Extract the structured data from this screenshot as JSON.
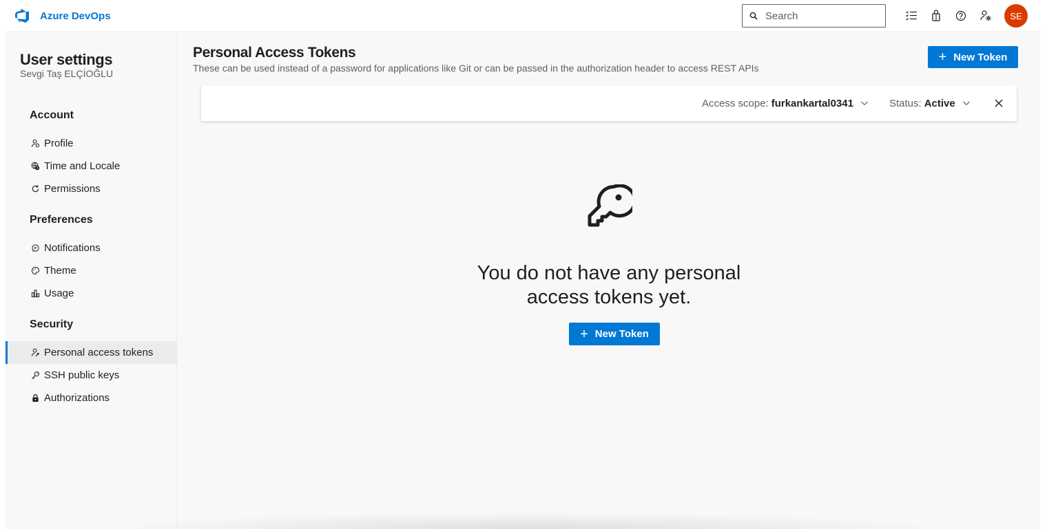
{
  "header": {
    "brand_name": "Azure DevOps",
    "search_placeholder": "Search",
    "avatar_initials": "SE",
    "icons": [
      "work-items-icon",
      "marketplace-bag-icon",
      "help-icon",
      "user-settings-icon"
    ],
    "avatar_color": "#da3b01"
  },
  "sidebar": {
    "title": "User settings",
    "user_name": "Sevgi Taş ELÇİOĞLU",
    "groups": [
      {
        "label": "Account",
        "items": [
          {
            "label": "Profile",
            "icon": "profile-icon"
          },
          {
            "label": "Time and Locale",
            "icon": "globe-clock-icon"
          },
          {
            "label": "Permissions",
            "icon": "refresh-icon"
          }
        ]
      },
      {
        "label": "Preferences",
        "items": [
          {
            "label": "Notifications",
            "icon": "chat-icon"
          },
          {
            "label": "Theme",
            "icon": "palette-icon"
          },
          {
            "label": "Usage",
            "icon": "bar-chart-icon"
          }
        ]
      },
      {
        "label": "Security",
        "items": [
          {
            "label": "Personal access tokens",
            "icon": "user-key-icon",
            "selected": true
          },
          {
            "label": "SSH public keys",
            "icon": "key-icon"
          },
          {
            "label": "Authorizations",
            "icon": "lock-icon"
          }
        ]
      }
    ]
  },
  "main": {
    "title": "Personal Access Tokens",
    "description": "These can be used instead of a password for applications like Git or can be passed in the authorization header to access REST APIs",
    "new_token_label": "New Token",
    "filter": {
      "scope_label": "Access scope:",
      "scope_value": "furkankartal0341",
      "status_label": "Status:",
      "status_value": "Active"
    },
    "empty_state": {
      "message": "You do not have any personal\naccess tokens yet.",
      "button_label": "New Token"
    }
  },
  "colors": {
    "accent": "#0078d4",
    "background": "#f8f8f8"
  }
}
